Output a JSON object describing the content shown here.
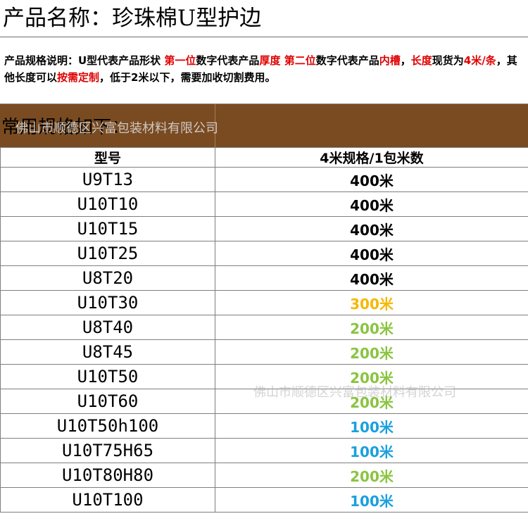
{
  "title": "产品名称：珍珠棉U型护边",
  "spec_segments": [
    {
      "text": "产品规格说明：U型代表产品形状 ",
      "red": false
    },
    {
      "text": "第一位",
      "red": true
    },
    {
      "text": "数字代表产品",
      "red": false
    },
    {
      "text": "厚度",
      "red": true
    },
    {
      "text": " ",
      "red": false
    },
    {
      "text": "第二位",
      "red": true
    },
    {
      "text": "数字代表产品",
      "red": false
    },
    {
      "text": "内槽",
      "red": true
    },
    {
      "text": "，",
      "red": false
    },
    {
      "text": "长度",
      "red": true
    },
    {
      "text": "现货为",
      "red": false
    },
    {
      "text": "4米/条",
      "red": true
    },
    {
      "text": "，其他长度可以",
      "red": false
    },
    {
      "text": "按需定制",
      "red": true
    },
    {
      "text": "，低于2米以下，需要加收切割费用。",
      "red": false
    }
  ],
  "section_header": "常用规格如下：",
  "watermark": "佛山市顺德区兴富包装材料有限公司",
  "table": {
    "headers": [
      "型号",
      "4米规格/1包米数"
    ],
    "rows": [
      {
        "model": "U9T13",
        "qty": "400米",
        "color": "#000000"
      },
      {
        "model": "U10T10",
        "qty": "400米",
        "color": "#000000"
      },
      {
        "model": "U10T15",
        "qty": "400米",
        "color": "#000000"
      },
      {
        "model": "U10T25",
        "qty": "400米",
        "color": "#000000"
      },
      {
        "model": "U8T20",
        "qty": "400米",
        "color": "#000000"
      },
      {
        "model": "U10T30",
        "qty": "300米",
        "color": "#f5b800"
      },
      {
        "model": "U8T40",
        "qty": "200米",
        "color": "#8ac440"
      },
      {
        "model": "U8T45",
        "qty": "200米",
        "color": "#8ac440"
      },
      {
        "model": "U10T50",
        "qty": "200米",
        "color": "#8ac440"
      },
      {
        "model": "U10T60",
        "qty": "200米",
        "color": "#8ac440"
      },
      {
        "model": "U10T50h100",
        "qty": "100米",
        "color": "#1aa0e0"
      },
      {
        "model": "U10T75H65",
        "qty": "100米",
        "color": "#1aa0e0"
      },
      {
        "model": "U10T80H80",
        "qty": "200米",
        "color": "#8ac440"
      },
      {
        "model": "U10T100",
        "qty": "100米",
        "color": "#1aa0e0"
      }
    ]
  }
}
